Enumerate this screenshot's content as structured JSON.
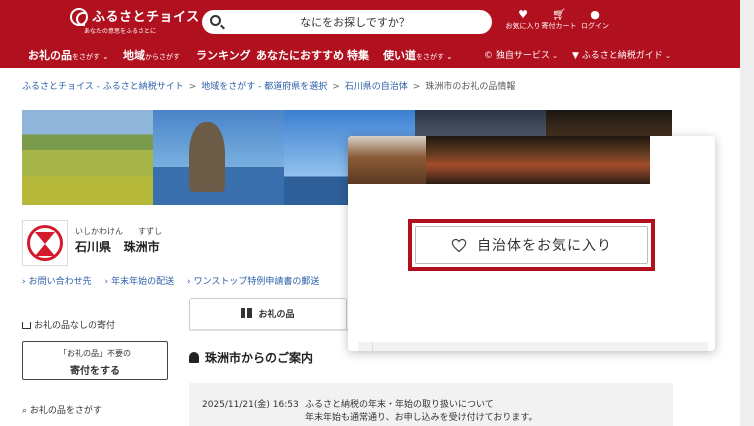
{
  "header": {
    "brand": "ふるさとチョイス",
    "brand_sub": "あなたの意思をふるさとに",
    "search_placeholder": "なにをお探しですか？",
    "icons": [
      {
        "name": "heart-icon",
        "label": "お気に入り"
      },
      {
        "name": "cart-icon",
        "label": "寄付カート"
      },
      {
        "name": "user-icon",
        "label": "ログイン"
      }
    ],
    "nav": {
      "gifts_main": "お礼の品",
      "gifts_sub": "をさがす",
      "region_main": "地域",
      "region_sub": "からさがす",
      "ranking": "ランキング",
      "recommend": "あなたにおすすめ",
      "features": "特集",
      "usage_main": "使い道",
      "usage_sub": "をさがす",
      "original_service": "独自サービス",
      "guide": "ふるさと納税ガイド"
    },
    "colors": {
      "brand_red": "#b1111f"
    }
  },
  "breadcrumb": {
    "items": [
      "ふるさとチョイス - ふるさと納税サイト",
      "地域をさがす - 都道府県を選択",
      "石川県の自治体"
    ],
    "current": "珠洲市のお礼の品情報",
    "separator": ">"
  },
  "municipality": {
    "pref_ruby": "いしかわけん",
    "city_ruby": "すずし",
    "prefecture": "石川県",
    "city": "珠洲市"
  },
  "links": [
    "お問い合わせ先",
    "年末年始の配送",
    "ワンストップ特例申請書の郵送"
  ],
  "sidebar": {
    "no_gift_heading": "お礼の品なしの寄付",
    "no_gift_button_line1": "「お礼の品」不要の",
    "no_gift_button_line2": "寄付をする",
    "search_heading": "お礼の品をさがす"
  },
  "tabs": {
    "gifts": "お礼の品"
  },
  "notice": {
    "heading": "珠洲市からのご案内",
    "date": "2025/11/21(金) 16:53",
    "title": "ふるさと納税の年末・年始の取り扱いについて",
    "body": "年末年始も通常通り、お申し込みを受け付けております。"
  },
  "popup": {
    "favorite_label": "自治体をお気に入り"
  }
}
